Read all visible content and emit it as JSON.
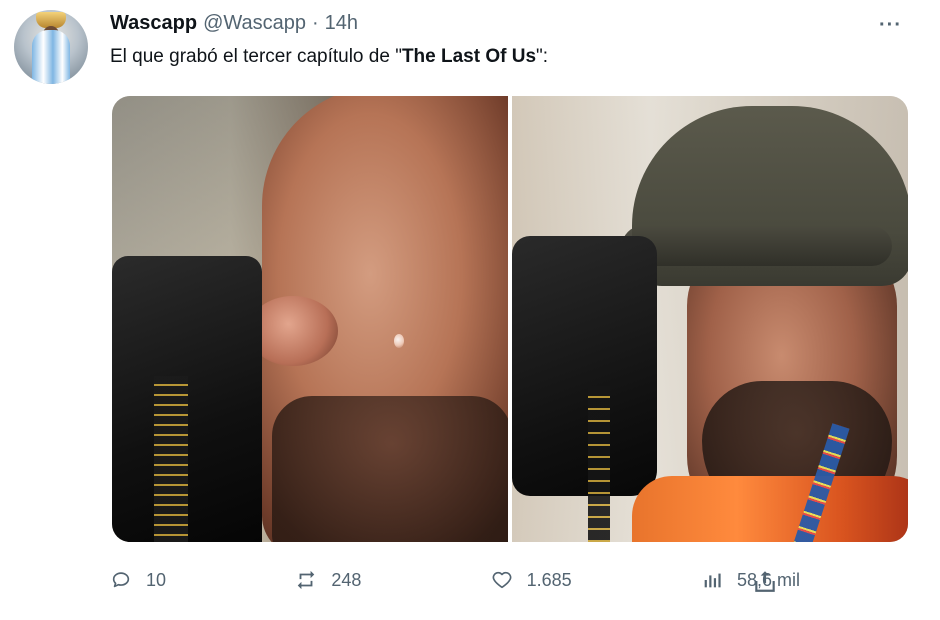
{
  "tweet": {
    "author": {
      "display_name": "Wascapp",
      "handle": "@Wascapp",
      "time": "14h"
    },
    "text_prefix": "El que grabó el tercer capítulo de ",
    "text_quote_open": "\"",
    "text_bold": "The Last Of Us",
    "text_quote_close_colon": "\":"
  },
  "actions": {
    "reply_count": "10",
    "retweet_count": "248",
    "like_count": "1.685",
    "views_count": "58,6 mil"
  },
  "icons": {
    "more": "more-icon",
    "reply": "reply-icon",
    "retweet": "retweet-icon",
    "like": "heart-icon",
    "views": "analytics-icon",
    "share": "share-icon"
  },
  "colors": {
    "text_primary": "#0f1419",
    "text_secondary": "#536471",
    "background": "#ffffff"
  }
}
